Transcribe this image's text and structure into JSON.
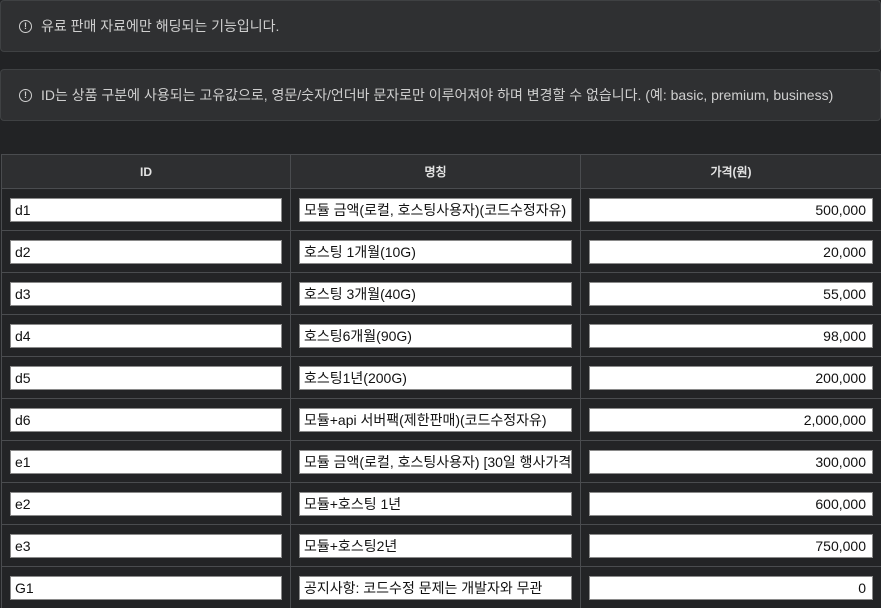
{
  "notices": {
    "paid_only": "유료 판매 자료에만 해딩되는 기능입니다.",
    "id_rule": "ID는 상품 구분에 사용되는 고유값으로, 영문/숫자/언더바 문자로만 이루어져야 하며 변경할 수 없습니다. (예: basic, premium, business)"
  },
  "table": {
    "headers": [
      "ID",
      "명칭",
      "가격(원)"
    ],
    "rows": [
      {
        "id": "d1",
        "name": "모듈 금액(로컬, 호스팅사용자)(코드수정자유)",
        "price": "500,000"
      },
      {
        "id": "d2",
        "name": "호스팅 1개월(10G)",
        "price": "20,000"
      },
      {
        "id": "d3",
        "name": "호스팅 3개월(40G)",
        "price": "55,000"
      },
      {
        "id": "d4",
        "name": "호스팅6개월(90G)",
        "price": "98,000"
      },
      {
        "id": "d5",
        "name": "호스팅1년(200G)",
        "price": "200,000"
      },
      {
        "id": "d6",
        "name": "모듈+api 서버팩(제한판매)(코드수정자유)",
        "price": "2,000,000"
      },
      {
        "id": "e1",
        "name": "모듈 금액(로컬, 호스팅사용자) [30일 행사가격",
        "price": "300,000"
      },
      {
        "id": "e2",
        "name": "모듈+호스팅 1년",
        "price": "600,000"
      },
      {
        "id": "e3",
        "name": "모듈+호스팅2년",
        "price": "750,000"
      },
      {
        "id": "G1",
        "name": "공지사항: 코드수정 문제는 개발자와 무관",
        "price": "0"
      }
    ]
  },
  "icons": {
    "info": "info-circle-icon"
  }
}
